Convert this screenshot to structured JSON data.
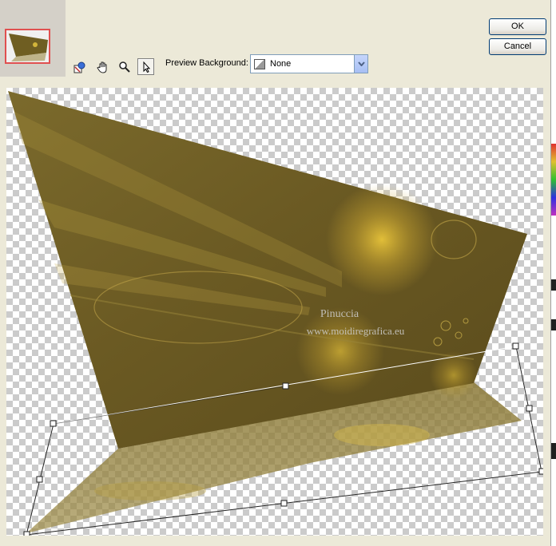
{
  "toolbar": {
    "preview_background_label": "Preview Background:",
    "preview_background_value": "None",
    "tools": [
      "pan-view-icon",
      "hand-icon",
      "zoom-icon",
      "pointer-icon"
    ]
  },
  "buttons": {
    "ok": "OK",
    "cancel": "Cancel"
  },
  "canvas": {
    "watermark_line1": "Pinuccia",
    "watermark_line2": "www.moidiregrafica.eu",
    "image_tone_color": "#6f5e22"
  }
}
